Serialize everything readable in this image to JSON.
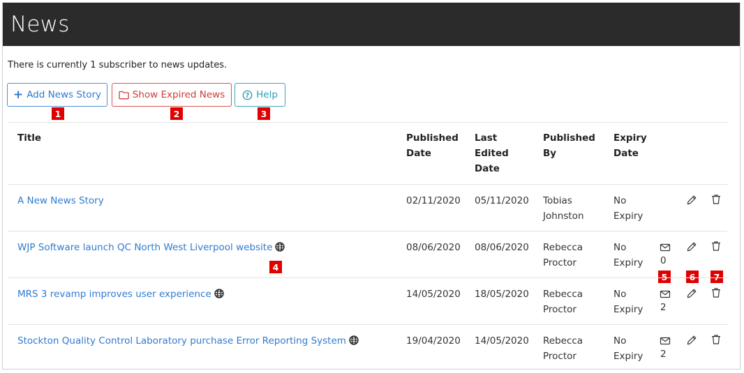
{
  "page": {
    "title": "News",
    "subscriber_text": "There is currently 1 subscriber to news updates."
  },
  "toolbar": {
    "add_label": "Add News Story",
    "expired_label": "Show Expired News",
    "help_label": "Help"
  },
  "markers": [
    "1",
    "2",
    "3",
    "4",
    "5",
    "6",
    "7"
  ],
  "table": {
    "headers": {
      "title": "Title",
      "published_date": [
        "Published",
        "Date"
      ],
      "last_edited": [
        "Last",
        "Edited",
        "Date"
      ],
      "published_by": [
        "Published",
        "By"
      ],
      "expiry": [
        "Expiry",
        "Date"
      ]
    },
    "rows": [
      {
        "title": "A New News Story",
        "published": "02/11/2020",
        "edited": "05/11/2020",
        "by": [
          "Tobias",
          "Johnston"
        ],
        "expiry": [
          "No",
          "Expiry"
        ],
        "globe": false,
        "mail_count": null
      },
      {
        "title": "WJP Software launch QC North West Liverpool website",
        "published": "08/06/2020",
        "edited": "08/06/2020",
        "by": [
          "Rebecca",
          "Proctor"
        ],
        "expiry": [
          "No",
          "Expiry"
        ],
        "globe": true,
        "mail_count": "0"
      },
      {
        "title": "MRS 3 revamp improves user experience",
        "published": "14/05/2020",
        "edited": "18/05/2020",
        "by": [
          "Rebecca",
          "Proctor"
        ],
        "expiry": [
          "No",
          "Expiry"
        ],
        "globe": true,
        "mail_count": "2"
      },
      {
        "title": "Stockton Quality Control Laboratory purchase Error Reporting System",
        "published": "19/04/2020",
        "edited": "14/05/2020",
        "by": [
          "Rebecca",
          "Proctor"
        ],
        "expiry": [
          "No",
          "Expiry"
        ],
        "globe": true,
        "mail_count": "2"
      }
    ]
  },
  "colors": {
    "header_bg": "#2b2b2b",
    "primary": "#2f7bd0",
    "danger": "#cf3b37",
    "info": "#2d9fb0",
    "marker": "#e00000"
  }
}
